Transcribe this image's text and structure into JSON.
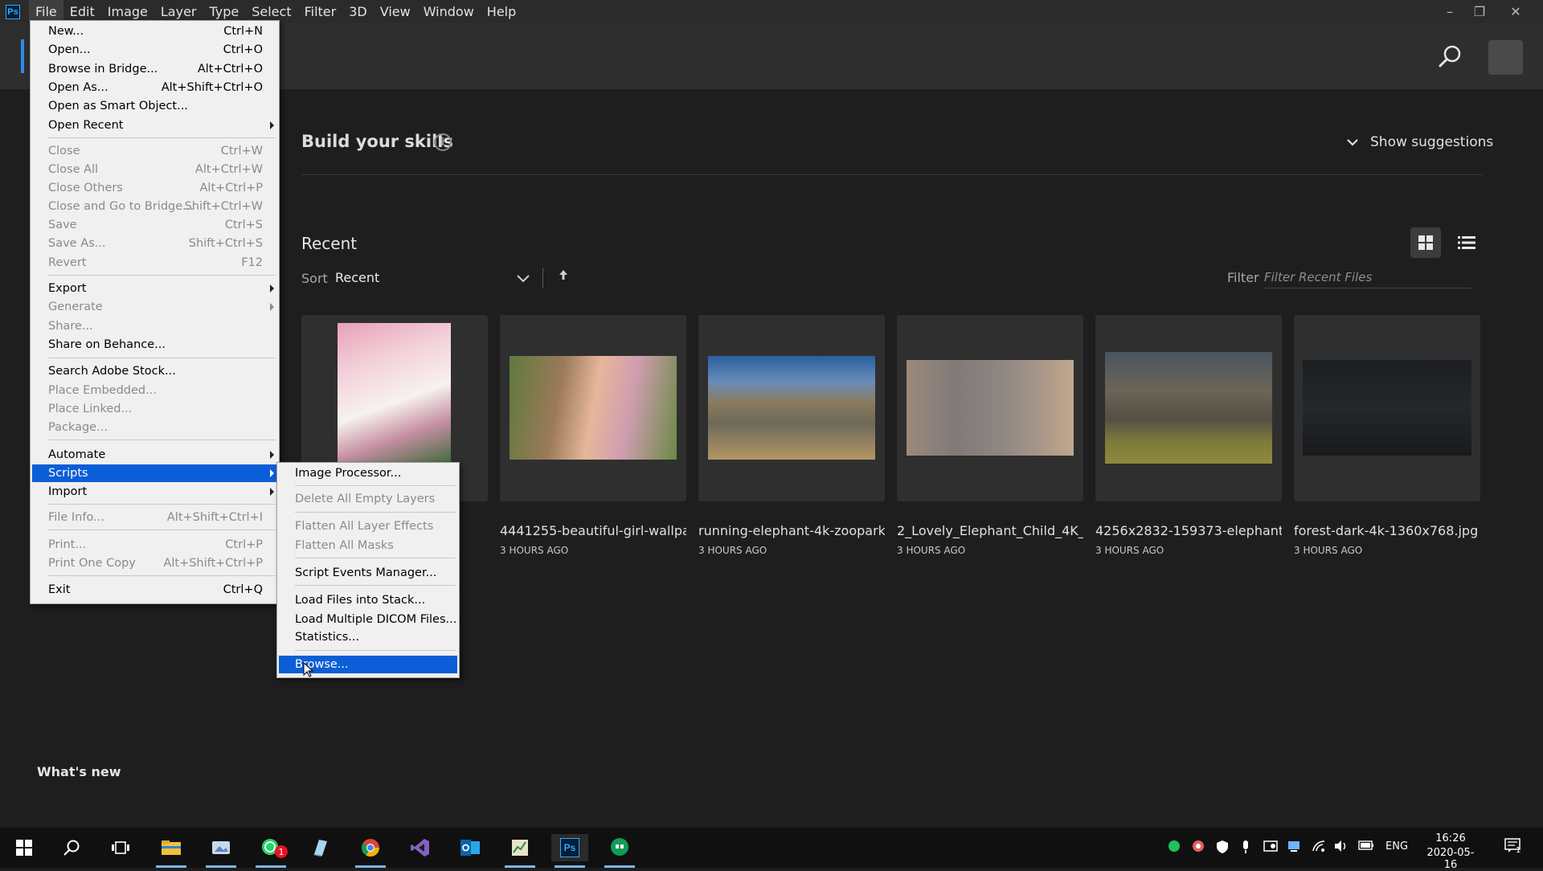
{
  "app": {
    "logo": "Ps"
  },
  "menubar": {
    "items": [
      "File",
      "Edit",
      "Image",
      "Layer",
      "Type",
      "Select",
      "Filter",
      "3D",
      "View",
      "Window",
      "Help"
    ]
  },
  "window_controls": {
    "minimize": "–",
    "restore": "❐",
    "close": "✕"
  },
  "home": {
    "skills_title": "Build your skills",
    "skills_info": "i",
    "show_suggestions": "Show suggestions",
    "recent_title": "Recent",
    "sort_label": "Sort",
    "sort_value": "Recent",
    "filter_label": "Filter",
    "filter_placeholder": "Filter Recent Files",
    "whats_new": "What's new"
  },
  "recent_files": [
    {
      "name": "",
      "time": ""
    },
    {
      "name": "4441255-beautiful-girl-wallpap...",
      "time": "3 HOURS AGO"
    },
    {
      "name": "running-elephant-4k-zoopark-...",
      "time": "3 HOURS AGO"
    },
    {
      "name": "2_Lovely_Elephant_Child_4K_...",
      "time": "3 HOURS AGO"
    },
    {
      "name": "4256x2832-159373-elephant-4...",
      "time": "3 HOURS AGO"
    },
    {
      "name": "forest-dark-4k-1360x768.jpg",
      "time": "3 HOURS AGO"
    }
  ],
  "file_menu": [
    {
      "label": "New...",
      "shortcut": "Ctrl+N"
    },
    {
      "label": "Open...",
      "shortcut": "Ctrl+O"
    },
    {
      "label": "Browse in Bridge...",
      "shortcut": "Alt+Ctrl+O"
    },
    {
      "label": "Open As...",
      "shortcut": "Alt+Shift+Ctrl+O"
    },
    {
      "label": "Open as Smart Object..."
    },
    {
      "label": "Open Recent"
    },
    {
      "label": "Close",
      "shortcut": "Ctrl+W"
    },
    {
      "label": "Close All",
      "shortcut": "Alt+Ctrl+W"
    },
    {
      "label": "Close Others",
      "shortcut": "Alt+Ctrl+P"
    },
    {
      "label": "Close and Go to Bridge...",
      "shortcut": "Shift+Ctrl+W"
    },
    {
      "label": "Save",
      "shortcut": "Ctrl+S"
    },
    {
      "label": "Save As...",
      "shortcut": "Shift+Ctrl+S"
    },
    {
      "label": "Revert",
      "shortcut": "F12"
    },
    {
      "label": "Export"
    },
    {
      "label": "Generate"
    },
    {
      "label": "Share..."
    },
    {
      "label": "Share on Behance..."
    },
    {
      "label": "Search Adobe Stock..."
    },
    {
      "label": "Place Embedded..."
    },
    {
      "label": "Place Linked..."
    },
    {
      "label": "Package..."
    },
    {
      "label": "Automate"
    },
    {
      "label": "Scripts"
    },
    {
      "label": "Import"
    },
    {
      "label": "File Info...",
      "shortcut": "Alt+Shift+Ctrl+I"
    },
    {
      "label": "Print...",
      "shortcut": "Ctrl+P"
    },
    {
      "label": "Print One Copy",
      "shortcut": "Alt+Shift+Ctrl+P"
    },
    {
      "label": "Exit",
      "shortcut": "Ctrl+Q"
    }
  ],
  "scripts_menu": [
    {
      "label": "Image Processor..."
    },
    {
      "label": "Delete All Empty Layers"
    },
    {
      "label": "Flatten All Layer Effects"
    },
    {
      "label": "Flatten All Masks"
    },
    {
      "label": "Script Events Manager..."
    },
    {
      "label": "Load Files into Stack..."
    },
    {
      "label": "Load Multiple DICOM Files..."
    },
    {
      "label": "Statistics..."
    },
    {
      "label": "Browse..."
    }
  ],
  "taskbar": {
    "whatsapp_badge": "1",
    "ps_label": "Ps",
    "lang": "ENG",
    "time": "16:26",
    "date": "2020-05-16",
    "notification_badge": "1"
  }
}
